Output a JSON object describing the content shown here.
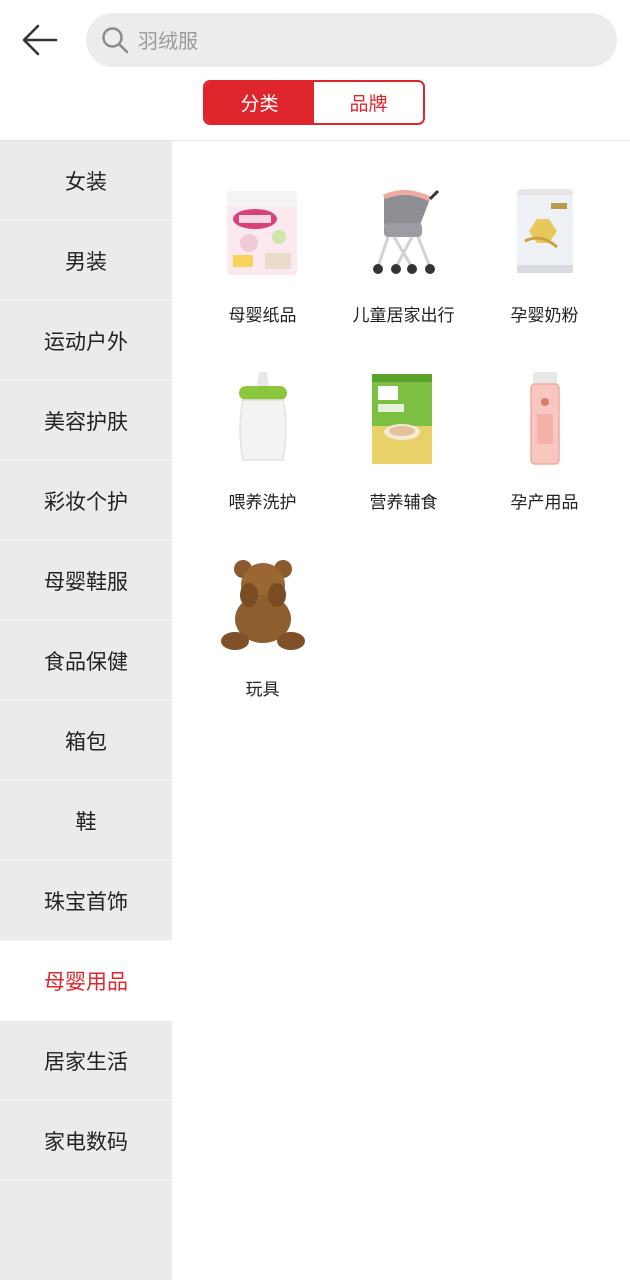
{
  "header": {
    "search_placeholder": "羽绒服",
    "tabs": [
      {
        "label": "分类",
        "active": true
      },
      {
        "label": "品牌",
        "active": false
      }
    ]
  },
  "sidebar": {
    "items": [
      {
        "label": "女装"
      },
      {
        "label": "男装"
      },
      {
        "label": "运动户外"
      },
      {
        "label": "美容护肤"
      },
      {
        "label": "彩妆个护"
      },
      {
        "label": "母婴鞋服"
      },
      {
        "label": "食品保健"
      },
      {
        "label": "箱包"
      },
      {
        "label": "鞋"
      },
      {
        "label": "珠宝首饰"
      },
      {
        "label": "母婴用品",
        "active": true
      },
      {
        "label": "居家生活"
      },
      {
        "label": "家电数码"
      }
    ]
  },
  "categories": [
    {
      "label": "母婴纸品",
      "icon": "diaper-pack-icon"
    },
    {
      "label": "儿童居家出行",
      "icon": "stroller-icon"
    },
    {
      "label": "孕婴奶粉",
      "icon": "formula-can-icon"
    },
    {
      "label": "喂养洗护",
      "icon": "baby-bottle-icon"
    },
    {
      "label": "营养辅食",
      "icon": "cereal-box-icon"
    },
    {
      "label": "孕产用品",
      "icon": "oil-bottle-icon"
    },
    {
      "label": "玩具",
      "icon": "teddy-bear-icon"
    }
  ],
  "colors": {
    "accent": "#e0262d",
    "sidebar_bg": "#ebebeb",
    "search_bg": "#ececec"
  }
}
